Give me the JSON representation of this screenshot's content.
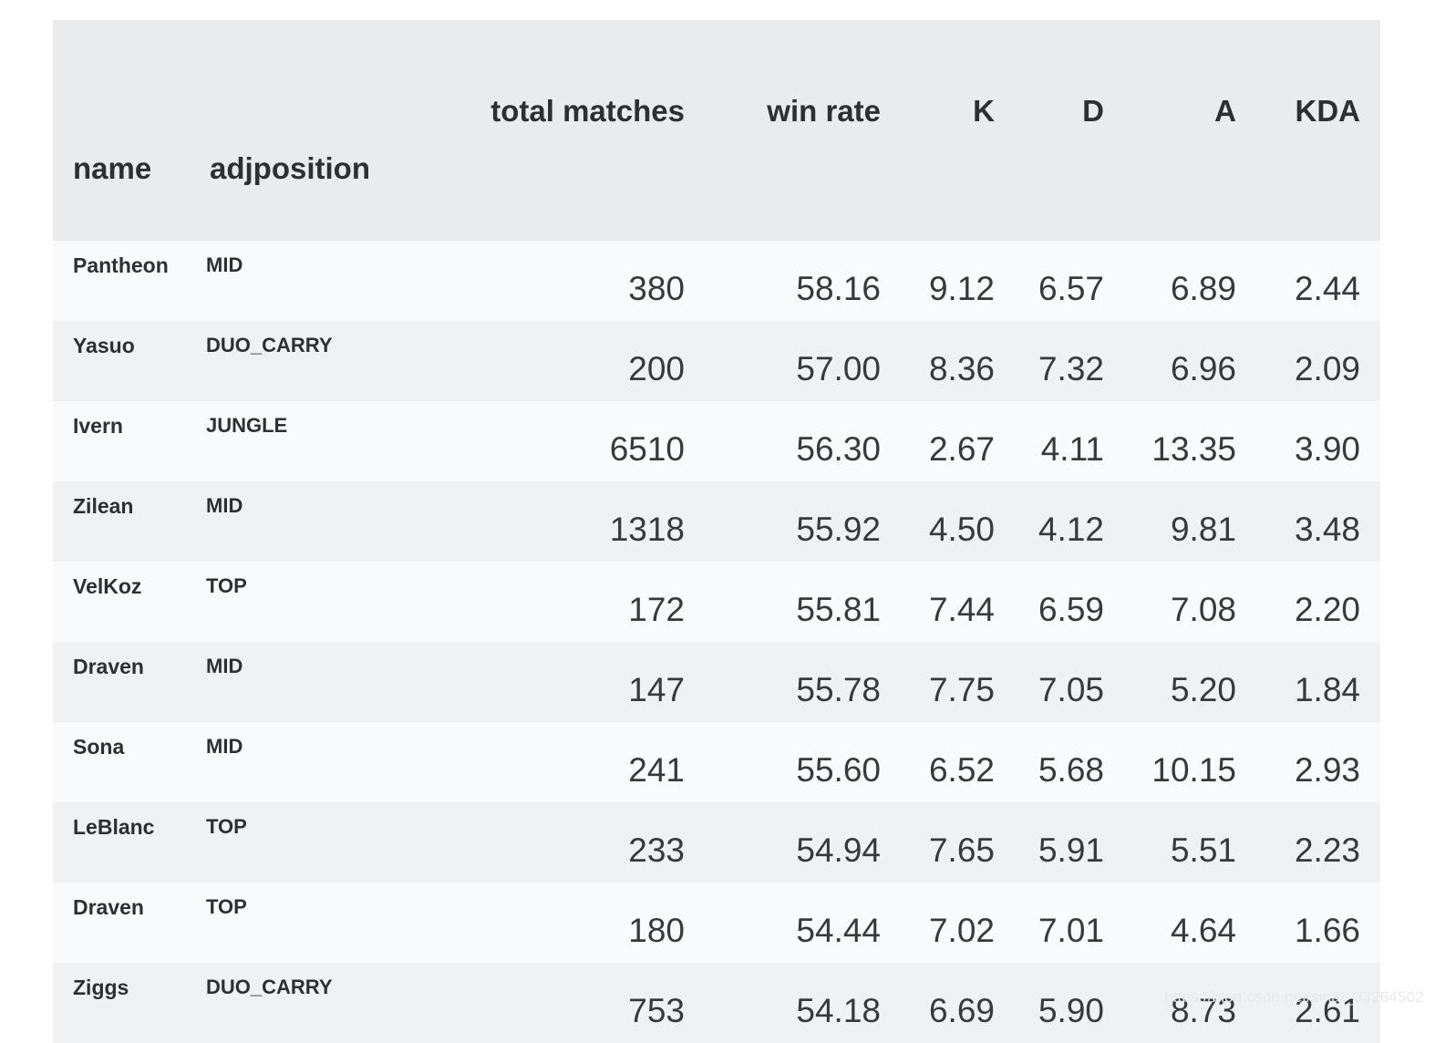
{
  "table": {
    "index_names": [
      "name",
      "adjposition"
    ],
    "column_headers": [
      "total matches",
      "win rate",
      "K",
      "D",
      "A",
      "KDA"
    ],
    "rows": [
      {
        "name": "Pantheon",
        "adjposition": "MID",
        "total_matches": "380",
        "win_rate": "58.16",
        "K": "9.12",
        "D": "6.57",
        "A": "6.89",
        "KDA": "2.44"
      },
      {
        "name": "Yasuo",
        "adjposition": "DUO_CARRY",
        "total_matches": "200",
        "win_rate": "57.00",
        "K": "8.36",
        "D": "7.32",
        "A": "6.96",
        "KDA": "2.09"
      },
      {
        "name": "Ivern",
        "adjposition": "JUNGLE",
        "total_matches": "6510",
        "win_rate": "56.30",
        "K": "2.67",
        "D": "4.11",
        "A": "13.35",
        "KDA": "3.90"
      },
      {
        "name": "Zilean",
        "adjposition": "MID",
        "total_matches": "1318",
        "win_rate": "55.92",
        "K": "4.50",
        "D": "4.12",
        "A": "9.81",
        "KDA": "3.48"
      },
      {
        "name": "VelKoz",
        "adjposition": "TOP",
        "total_matches": "172",
        "win_rate": "55.81",
        "K": "7.44",
        "D": "6.59",
        "A": "7.08",
        "KDA": "2.20"
      },
      {
        "name": "Draven",
        "adjposition": "MID",
        "total_matches": "147",
        "win_rate": "55.78",
        "K": "7.75",
        "D": "7.05",
        "A": "5.20",
        "KDA": "1.84"
      },
      {
        "name": "Sona",
        "adjposition": "MID",
        "total_matches": "241",
        "win_rate": "55.60",
        "K": "6.52",
        "D": "5.68",
        "A": "10.15",
        "KDA": "2.93"
      },
      {
        "name": "LeBlanc",
        "adjposition": "TOP",
        "total_matches": "233",
        "win_rate": "54.94",
        "K": "7.65",
        "D": "5.91",
        "A": "5.51",
        "KDA": "2.23"
      },
      {
        "name": "Draven",
        "adjposition": "TOP",
        "total_matches": "180",
        "win_rate": "54.44",
        "K": "7.02",
        "D": "7.01",
        "A": "4.64",
        "KDA": "1.66"
      },
      {
        "name": "Ziggs",
        "adjposition": "DUO_CARRY",
        "total_matches": "753",
        "win_rate": "54.18",
        "K": "6.69",
        "D": "5.90",
        "A": "8.73",
        "KDA": "2.61"
      }
    ]
  },
  "watermark": "https://blog.csdn.net/sinat_33264502",
  "colors": {
    "header_bg": "#eaebed",
    "row_odd_bg": "#f9fafb",
    "row_even_bg": "#f0f1f3",
    "text": "#2d2f31",
    "page_bg": "#ffffff"
  }
}
